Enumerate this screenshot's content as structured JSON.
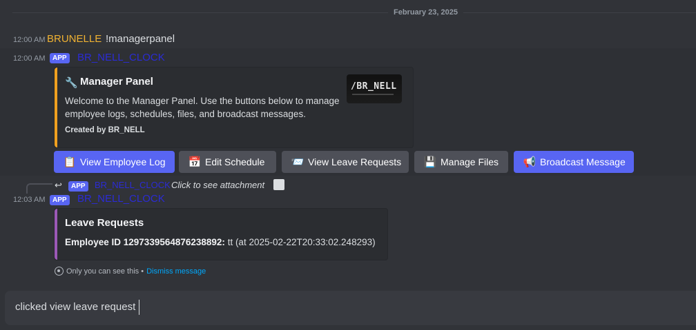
{
  "date_divider": "February 23, 2025",
  "messages": [
    {
      "time": "12:00 AM",
      "author": "BRUNELLE",
      "text": "!managerpanel"
    },
    {
      "time": "12:00 AM",
      "badge": "APP",
      "author": "BR_NELL_CLOCK"
    }
  ],
  "manager_embed": {
    "accent": "#f0a020",
    "icon": "wrench-icon",
    "title": "Manager Panel",
    "description": "Welcome to the Manager Panel. Use the buttons below to manage employee logs, schedules, files, and broadcast messages.",
    "footer": "Created by BR_NELL",
    "thumbnail_text": "/BR_NELL"
  },
  "buttons": [
    {
      "icon": "clipboard-icon",
      "label": "View Employee Log"
    },
    {
      "icon": "calendar-icon",
      "label": "Edit Schedule"
    },
    {
      "icon": "envelope-icon",
      "label": "View Leave Requests"
    },
    {
      "icon": "floppy-disk-icon",
      "label": "Manage Files"
    },
    {
      "icon": "megaphone-icon",
      "label": "Broadcast Message"
    }
  ],
  "reply": {
    "badge": "APP",
    "author": "BR_NELL_CLOCK",
    "text": "Click to see attachment"
  },
  "message3": {
    "time": "12:03 AM",
    "badge": "APP",
    "author": "BR_NELL_CLOCK"
  },
  "leave_embed": {
    "accent": "#9b59b6",
    "title": "Leave Requests",
    "entry_label": "Employee ID 1297339564876238892:",
    "entry_value": " tt (at 2025-02-22T20:33:02.248293)"
  },
  "ephemeral": {
    "text": "Only you can see this • ",
    "link": "Dismiss message"
  },
  "input": {
    "value": "clicked view leave request"
  }
}
